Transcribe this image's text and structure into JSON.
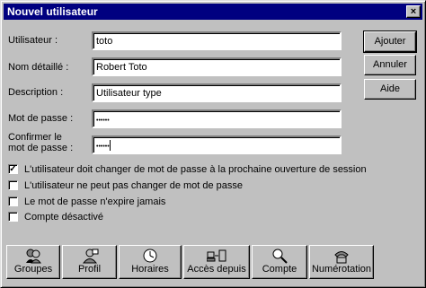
{
  "window": {
    "title": "Nouvel utilisateur",
    "close_glyph": "×"
  },
  "form": {
    "username": {
      "label": "Utilisateur :",
      "value": "toto"
    },
    "fullname": {
      "label": "Nom détaillé :",
      "value": "Robert Toto"
    },
    "description": {
      "label": "Description :",
      "value": "Utilisateur type"
    },
    "password": {
      "label": "Mot de passe :",
      "value": "••••••"
    },
    "confirm": {
      "label_line1": "Confirmer le",
      "label_line2": "mot de passe :",
      "value": "••••••"
    }
  },
  "side_buttons": {
    "add": "Ajouter",
    "cancel": "Annuler",
    "help": "Aide"
  },
  "options": {
    "must_change": {
      "label": "L'utilisateur doit changer de mot de passe à la prochaine ouverture de session",
      "checked": true
    },
    "cannot_change": {
      "label": "L'utilisateur ne peut pas changer de mot de passe",
      "checked": false
    },
    "never_expires": {
      "label": "Le mot de passe n'expire jamais",
      "checked": false
    },
    "disabled": {
      "label": "Compte désactivé",
      "checked": false
    }
  },
  "toolbar": {
    "groups": {
      "label": "Groupes",
      "icon": "groups-icon"
    },
    "profile": {
      "label": "Profil",
      "icon": "profile-icon"
    },
    "hours": {
      "label": "Horaires",
      "icon": "clock-icon"
    },
    "logon_to": {
      "label": "Accès depuis",
      "icon": "workstations-icon"
    },
    "account": {
      "label": "Compte",
      "icon": "magnifier-icon"
    },
    "dialin": {
      "label": "Numérotation",
      "icon": "phone-icon"
    }
  },
  "colors": {
    "title_bar": "#000080",
    "face": "#c0c0c0"
  }
}
